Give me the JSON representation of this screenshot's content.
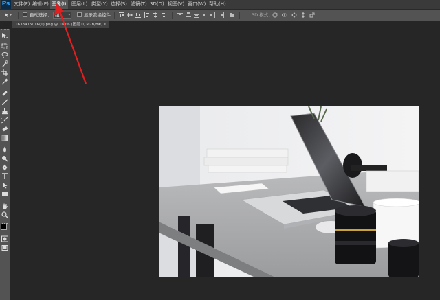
{
  "menubar": {
    "logo": "Ps",
    "items": [
      "文件(F)",
      "编辑(E)",
      "图像(I)",
      "图层(L)",
      "类型(Y)",
      "选择(S)",
      "滤镜(T)",
      "3D(D)",
      "视图(V)",
      "窗口(W)",
      "帮助(H)"
    ],
    "active_index": 2
  },
  "options": {
    "auto_select_label": "自动选择：",
    "auto_select_value": "组",
    "show_transform_label": "显示变换控件",
    "mode_3d_label": "3D 模式："
  },
  "document": {
    "tab_title": "1638415016(1).png @ 100% (图层 0, RGB/8#)",
    "close_glyph": "×"
  },
  "tools": [
    "move-tool-icon",
    "marquee-tool-icon",
    "lasso-tool-icon",
    "quick-select-tool-icon",
    "crop-tool-icon",
    "eyedropper-tool-icon",
    "healing-brush-tool-icon",
    "brush-tool-icon",
    "clone-stamp-tool-icon",
    "history-brush-tool-icon",
    "eraser-tool-icon",
    "gradient-tool-icon",
    "blur-tool-icon",
    "dodge-tool-icon",
    "pen-tool-icon",
    "type-tool-icon",
    "path-select-tool-icon",
    "rectangle-tool-icon",
    "hand-tool-icon",
    "zoom-tool-icon"
  ],
  "colors": {
    "annotation_arrow": "#e02020",
    "foreground": "#000000",
    "background": "#ffffff"
  }
}
